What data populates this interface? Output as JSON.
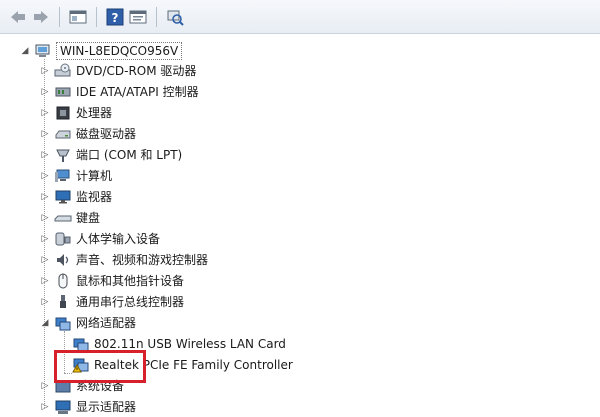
{
  "toolbar": {
    "buttons": [
      {
        "name": "back-button",
        "icon": "arrow-left-icon"
      },
      {
        "name": "forward-button",
        "icon": "arrow-right-icon"
      },
      {
        "name": "show-hide-tree-button",
        "icon": "console-tree-icon"
      },
      {
        "name": "help-button",
        "icon": "help-icon"
      },
      {
        "name": "properties-button",
        "icon": "properties-icon"
      },
      {
        "name": "scan-hardware-button",
        "icon": "scan-hardware-icon"
      }
    ]
  },
  "tree": {
    "root": {
      "label": "WIN-L8EDQCO956V",
      "icon": "computer-icon"
    },
    "items": [
      {
        "label": "DVD/CD-ROM 驱动器",
        "icon": "dvd-drive-icon",
        "expanded": false
      },
      {
        "label": "IDE ATA/ATAPI 控制器",
        "icon": "ide-controller-icon",
        "expanded": false
      },
      {
        "label": "处理器",
        "icon": "processor-icon",
        "expanded": false
      },
      {
        "label": "磁盘驱动器",
        "icon": "disk-drive-icon",
        "expanded": false
      },
      {
        "label": "端口 (COM 和 LPT)",
        "icon": "port-icon",
        "expanded": false
      },
      {
        "label": "计算机",
        "icon": "computer-icon",
        "expanded": false
      },
      {
        "label": "监视器",
        "icon": "monitor-icon",
        "expanded": false
      },
      {
        "label": "键盘",
        "icon": "keyboard-icon",
        "expanded": false
      },
      {
        "label": "人体学输入设备",
        "icon": "hid-icon",
        "expanded": false
      },
      {
        "label": "声音、视频和游戏控制器",
        "icon": "sound-icon",
        "expanded": false
      },
      {
        "label": "鼠标和其他指针设备",
        "icon": "mouse-icon",
        "expanded": false
      },
      {
        "label": "通用串行总线控制器",
        "icon": "usb-icon",
        "expanded": false
      },
      {
        "label": "网络适配器",
        "icon": "network-adapter-icon",
        "expanded": true,
        "children": [
          {
            "label": "802.11n USB Wireless LAN Card",
            "icon": "network-adapter-icon"
          },
          {
            "label": "Realtek PCIe FE Family Controller",
            "icon": "network-adapter-warning-icon"
          }
        ]
      },
      {
        "label": "系统设备",
        "icon": "system-device-icon",
        "expanded": false
      },
      {
        "label": "显示适配器",
        "icon": "display-adapter-icon",
        "expanded": false
      }
    ]
  },
  "colors": {
    "highlight": "#d6202b",
    "warning": "#f2c200",
    "toolbar_top": "#f6f8fb",
    "toolbar_bottom": "#e8edf4"
  }
}
